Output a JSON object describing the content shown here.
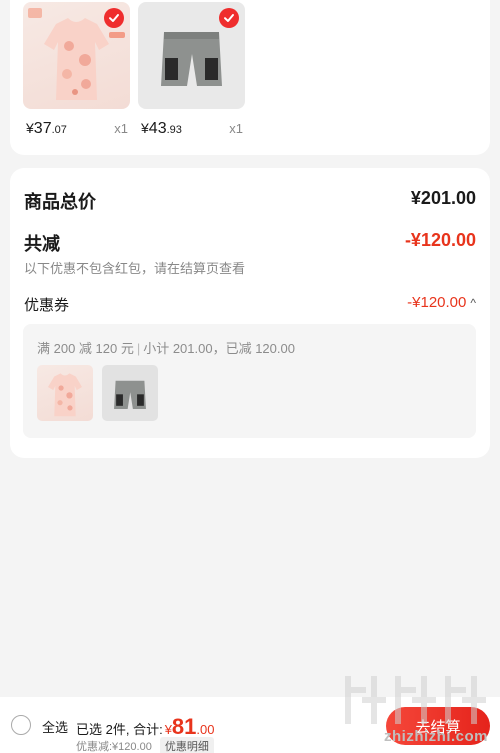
{
  "products": [
    {
      "name": "pink-dress",
      "currency": "¥",
      "price_int": "37",
      "price_dec": ".07",
      "qty": "x1",
      "selected": true
    },
    {
      "name": "grey-shorts",
      "currency": "¥",
      "price_int": "43",
      "price_dec": ".93",
      "qty": "x1",
      "selected": true
    }
  ],
  "summary": {
    "total_label": "商品总价",
    "total_value": "¥201.00",
    "reduce_label": "共减",
    "reduce_value": "-¥120.00",
    "reduce_note": "以下优惠不包含红包，请在结算页查看",
    "coupon_label": "优惠券",
    "coupon_value": "-¥120.00",
    "coupon_rule": "满 200 减 120 元",
    "coupon_subtotal": "小计 201.00，已减 120.00"
  },
  "bottom_bar": {
    "select_all": "全选",
    "selected_text": "已选 2件, 合计:",
    "currency": "¥",
    "total_int": "81",
    "total_dec": ".00",
    "discount_text": "优惠减:¥120.00",
    "detail_label": "优惠明细",
    "checkout_label": "去结算"
  },
  "watermark": "zhizhizhi.com",
  "colors": {
    "accent": "#e8341c",
    "check": "#ef2d2d"
  }
}
